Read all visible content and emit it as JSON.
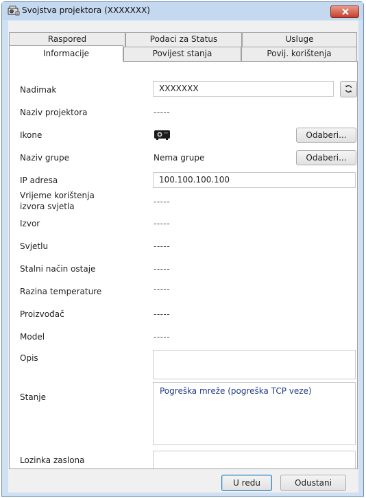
{
  "window": {
    "title": "Svojstva projektora (XXXXXXX)"
  },
  "tabs": {
    "row1": [
      "Raspored",
      "Podaci za Status",
      "Usluge"
    ],
    "row2": [
      "Informacije",
      "Povijest stanja",
      "Povij. korištenja"
    ],
    "active": "Informacije"
  },
  "info": {
    "nickname_label": "Nadimak",
    "nickname_value": "XXXXXXX",
    "projector_name_label": "Naziv projektora",
    "projector_name_value": "-----",
    "icons_label": "Ikone",
    "icons_button": "Odaberi...",
    "group_label": "Naziv grupe",
    "group_value": "Nema grupe",
    "group_button": "Odaberi...",
    "ip_label": "IP adresa",
    "ip_value": "100.100.100.100",
    "light_time_label_1": "Vrijeme korištenja",
    "light_time_label_2": "izvora svjetla",
    "light_time_value": "-----",
    "source_label": "Izvor",
    "source_value": "-----",
    "light_label": "Svjetlu",
    "light_value": "-----",
    "constant_mode_label": "Stalni način ostaje",
    "constant_mode_value": "-----",
    "temperature_label": "Razina temperature",
    "temperature_value": "-----",
    "manufacturer_label": "Proizvođač",
    "manufacturer_value": "-----",
    "model_label": "Model",
    "model_value": "-----",
    "description_label": "Opis",
    "description_value": "",
    "status_label": "Stanje",
    "status_value": "Pogreška mreže (pogreška TCP veze)",
    "password_label": "Lozinka zaslona",
    "password_value": ""
  },
  "footer": {
    "ok_label": "U redu",
    "cancel_label": "Odustani"
  },
  "icons": {
    "title_icon": "projector-properties-icon",
    "close": "close-icon",
    "refresh": "refresh-icon",
    "projector": "projector-icon"
  },
  "colors": {
    "titlebar": "#c4d9ef",
    "close_button": "#c7402c",
    "status_text": "#1f3a8a"
  }
}
